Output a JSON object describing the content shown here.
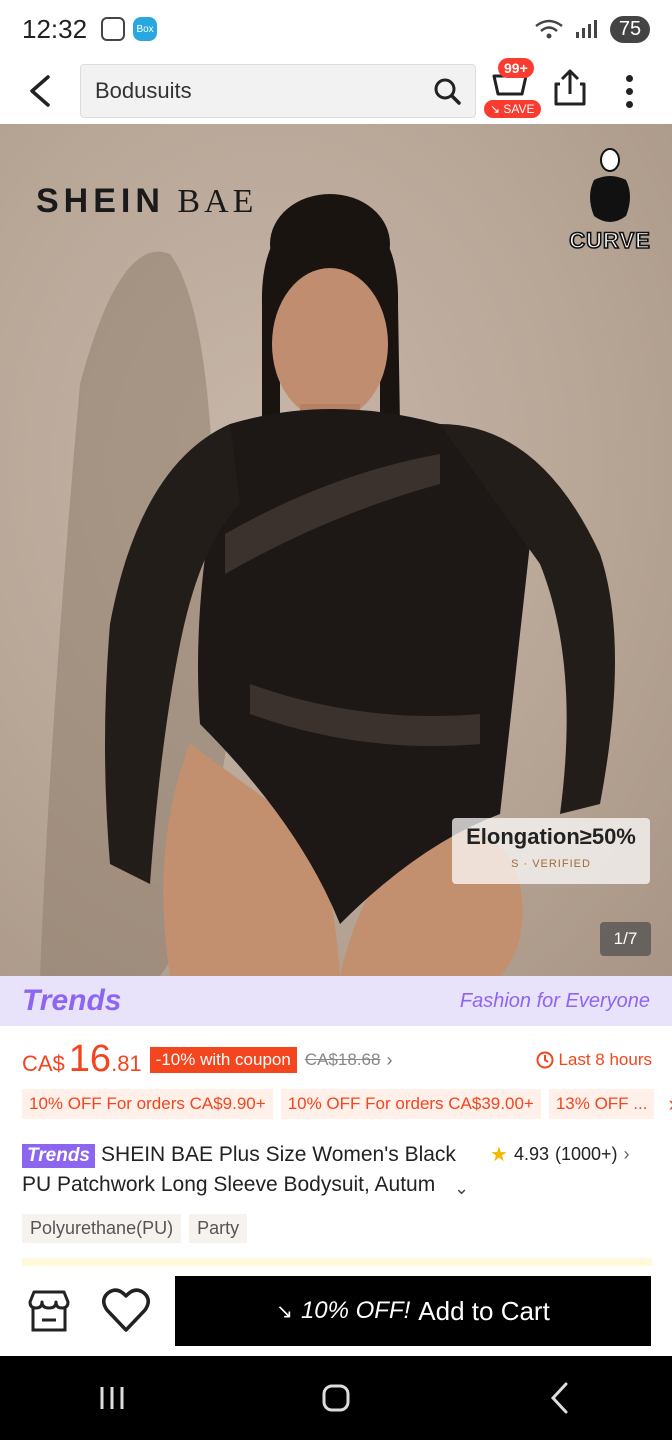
{
  "status": {
    "time": "12:32",
    "box_label": "Box",
    "network": "5",
    "battery": "75"
  },
  "header": {
    "search_value": "Bodusuits",
    "cart_badge": "99+",
    "save_label": "SAVE"
  },
  "hero": {
    "brand_bold": "SHEIN",
    "brand_light": "BAE",
    "curve_label": "CURVE",
    "elongation": "Elongation≥50%",
    "verified": "S · VERIFIED",
    "counter": "1/7"
  },
  "trends": {
    "logo": "Trends",
    "tagline": "Fashion for Everyone"
  },
  "price": {
    "currency": "CA$",
    "whole": "16",
    "cents": ".81",
    "coupon": "-10% with coupon",
    "original": "CA$18.68",
    "timer": "Last 8 hours"
  },
  "offers": [
    "10% OFF For orders CA$9.90+",
    "10% OFF For orders CA$39.00+",
    "13% OFF ..."
  ],
  "product": {
    "badge": "Trends",
    "title": "SHEIN BAE Plus Size Women's Black PU Patchwork Long Sleeve Bodysuit, Autum",
    "rating": "4.93",
    "reviews": "(1000+)",
    "tags": [
      "Polyurethane(PU)",
      "Party"
    ]
  },
  "actions": {
    "discount": "10% OFF!",
    "add_to_cart": "Add to Cart"
  },
  "colors": {
    "accent": "#f3451e",
    "trends": "#8d66f0",
    "badge": "#fa3b2f"
  }
}
